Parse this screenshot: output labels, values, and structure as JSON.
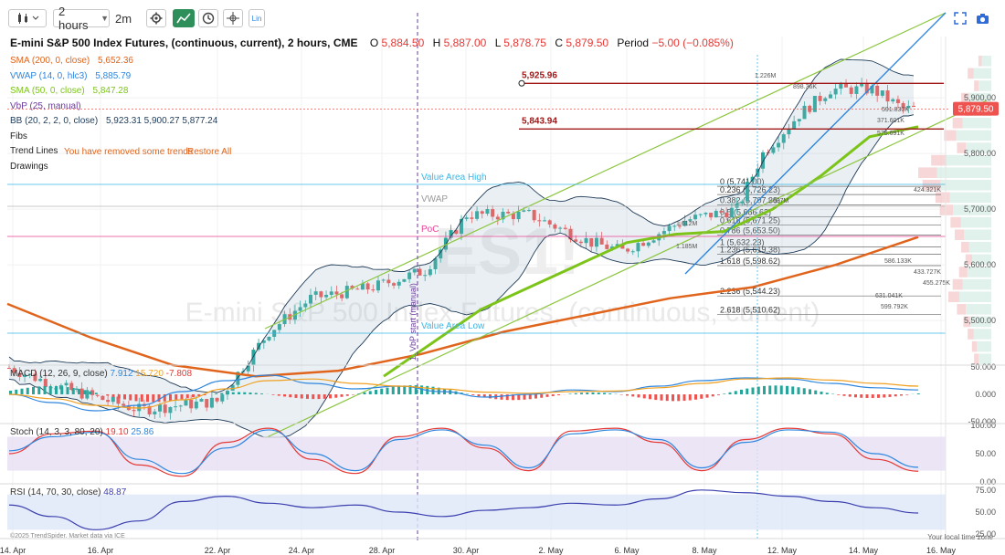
{
  "toolbar": {
    "interval_label": "2 hours",
    "interval_alt": "2m",
    "lin_label": "Lin"
  },
  "header": {
    "title": "E-mini S&P 500 Index Futures, (continuous, current), 2 hours, CME",
    "o_label": "O",
    "o_value": "5,884.50",
    "h_label": "H",
    "h_value": "5,887.00",
    "l_label": "L",
    "l_value": "5,878.75",
    "c_label": "C",
    "c_value": "5,879.50",
    "period_label": "Period",
    "period_value": "−5.00 (−0.085%)"
  },
  "legend": [
    {
      "label": "SMA (200, 0, close)",
      "value": "5,652.36",
      "color": "#e0641c"
    },
    {
      "label": "VWAP (14, 0, hlc3)",
      "value": "5,885.79",
      "color": "#2e86de"
    },
    {
      "label": "SMA (50, 0, close)",
      "value": "5,847.28",
      "color": "#7dc41a"
    },
    {
      "label": "VbP (25, manual)",
      "value": "",
      "color": "#6a3d9a"
    },
    {
      "label": "BB (20, 2, 2, 0, close)",
      "value": "5,923.31  5,900.27  5,877.24",
      "color": "#1f3b57"
    },
    {
      "label": "Fibs",
      "value": "",
      "color": "#222222"
    },
    {
      "label": "Trend Lines",
      "value": "",
      "color": "#222222"
    },
    {
      "label": "Drawings",
      "value": "",
      "color": "#222222"
    }
  ],
  "trendlines_note": "You have removed some trends",
  "restore_label": "Restore All",
  "watermark": "E-mini S&P 500 Index Futures, (continuous, current)",
  "watermark_ticker": "ES1!",
  "colors": {
    "up": "#26a69a",
    "down": "#ef5350",
    "sma200": "#e0641c",
    "sma50": "#7dc41a",
    "vwap": "#2e86de",
    "bb": "#1f3b57",
    "channel": "#8cc63f",
    "hline": "#a01818",
    "value_area": "#39b6e6",
    "poc": "#e84393",
    "price_badge": "#ef5350"
  },
  "chart_data": [
    {
      "type": "candlestick",
      "title": "E-mini S&P 500 Index Futures, (continuous, current), 2 hours, CME",
      "x_ticks": [
        "14. Apr",
        "16. Apr",
        "22. Apr",
        "24. Apr",
        "28. Apr",
        "30. Apr",
        "2. May",
        "6. May",
        "8. May",
        "12. May",
        "14. May",
        "16. May"
      ],
      "y_ticks": [
        "5,900.00",
        "5,800.00",
        "5,700.00",
        "5,600.00",
        "5,500.00"
      ],
      "y_range": [
        5420,
        6010
      ],
      "last_price": "5,879.50",
      "series_ohlc_close_keypoints": [
        {
          "t": 0,
          "close": 5415
        },
        {
          "t": 10,
          "close": 5380
        },
        {
          "t": 25,
          "close": 5340
        },
        {
          "t": 40,
          "close": 5355
        },
        {
          "t": 50,
          "close": 5480
        },
        {
          "t": 58,
          "close": 5540
        },
        {
          "t": 70,
          "close": 5560
        },
        {
          "t": 80,
          "close": 5590
        },
        {
          "t": 88,
          "close": 5690
        },
        {
          "t": 100,
          "close": 5690
        },
        {
          "t": 112,
          "close": 5640
        },
        {
          "t": 118,
          "close": 5625
        },
        {
          "t": 130,
          "close": 5680
        },
        {
          "t": 140,
          "close": 5700
        },
        {
          "t": 145,
          "close": 5800
        },
        {
          "t": 152,
          "close": 5870
        },
        {
          "t": 158,
          "close": 5915
        },
        {
          "t": 166,
          "close": 5915
        },
        {
          "t": 172,
          "close": 5880
        }
      ],
      "sma200_keypoints": [
        5530,
        5470,
        5420,
        5400,
        5410,
        5440,
        5480,
        5510,
        5540,
        5560,
        5600,
        5650
      ],
      "sma50_keypoints": [
        5400,
        5460,
        5520,
        5560,
        5600,
        5640,
        5655,
        5660,
        5700,
        5760,
        5830,
        5848
      ],
      "horizontal_lines": [
        {
          "label": "5,925.96",
          "value": 5925.96
        },
        {
          "label": "5,843.94",
          "value": 5843.94
        }
      ],
      "value_area": {
        "high_label": "Value Area High",
        "high": 5740,
        "low_label": "Value Area Low",
        "low": 5494,
        "poc_label": "PoC",
        "poc": 5648,
        "vwap_label": "VWAP",
        "vwap": 5700
      },
      "vertical_marker_label": "1. VbP start (manual)",
      "fibs": [
        {
          "label": "0 (5,741.00)",
          "value": 5741.0
        },
        {
          "label": "0.236 (5,726.23)",
          "value": 5726.23
        },
        {
          "label": "0.382 (5,707.38)",
          "value": 5707.38
        },
        {
          "label": "0.5 (5,686.62)",
          "value": 5686.62
        },
        {
          "label": "0.618 (5,671.25)",
          "value": 5671.25
        },
        {
          "label": "0.786 (5,653.50)",
          "value": 5653.5
        },
        {
          "label": "1 (5,632.23)",
          "value": 5632.23
        },
        {
          "label": "1.236 (5,619.38)",
          "value": 5619.38
        },
        {
          "label": "1.618 (5,598.62)",
          "value": 5598.62
        },
        {
          "label": "2.236 (5,544.23)",
          "value": 5544.23
        },
        {
          "label": "2.618 (5,510.62)",
          "value": 5510.62
        }
      ],
      "volume_profile_labels": [
        "1.226M",
        "898.36K",
        "591.830K",
        "371.601K",
        "575.691K",
        "1.687M",
        "1.612M",
        "1.185M",
        "424.321K",
        "586.133K",
        "433.727K",
        "455.275K",
        "631.041K",
        "599.792K"
      ]
    },
    {
      "type": "line",
      "title": "MACD (12, 26, 9, close)",
      "values_label": [
        "7.912",
        "15.720",
        "-7.808"
      ],
      "y_ticks": [
        "50.000",
        "0.000",
        "-50.000"
      ],
      "y_range": [
        -50,
        50
      ],
      "series": [
        {
          "name": "MACD",
          "values": [
            0,
            -15,
            -30,
            -20,
            5,
            25,
            35,
            20,
            10,
            15,
            5,
            -5,
            0,
            8,
            5,
            15,
            25,
            30,
            28,
            20,
            12,
            8
          ]
        },
        {
          "name": "Signal",
          "values": [
            0,
            -8,
            -20,
            -25,
            -10,
            10,
            25,
            28,
            20,
            15,
            10,
            4,
            2,
            5,
            6,
            12,
            20,
            28,
            30,
            26,
            20,
            15
          ]
        }
      ]
    },
    {
      "type": "line",
      "title": "Stoch (14, 3, 3, 80, 20)",
      "values_label": [
        "19.10",
        "25.86"
      ],
      "y_ticks": [
        "100.00",
        "50.00",
        "0.00"
      ],
      "y_range": [
        0,
        100
      ],
      "band": [
        20,
        80
      ],
      "series": [
        {
          "name": "%K",
          "values": [
            50,
            85,
            90,
            30,
            10,
            70,
            95,
            40,
            15,
            80,
            95,
            60,
            20,
            90,
            95,
            70,
            20,
            75,
            95,
            85,
            40,
            19
          ]
        },
        {
          "name": "%D",
          "values": [
            55,
            80,
            88,
            40,
            15,
            60,
            92,
            50,
            20,
            75,
            92,
            65,
            25,
            85,
            92,
            75,
            25,
            70,
            92,
            88,
            50,
            26
          ]
        }
      ]
    },
    {
      "type": "line",
      "title": "RSI (14, 70, 30, close)",
      "values_label": [
        "48.87"
      ],
      "y_ticks": [
        "75.00",
        "50.00",
        "25.00"
      ],
      "y_range": [
        20,
        80
      ],
      "band": [
        30,
        70
      ],
      "series": [
        {
          "name": "RSI",
          "values": [
            58,
            45,
            30,
            40,
            62,
            68,
            60,
            55,
            58,
            50,
            45,
            52,
            55,
            60,
            58,
            65,
            75,
            72,
            68,
            62,
            55,
            49
          ]
        }
      ]
    }
  ],
  "footer": {
    "copyright": "©2025 TrendSpider. Market data via ICE",
    "timezone": "Your local time zone"
  }
}
